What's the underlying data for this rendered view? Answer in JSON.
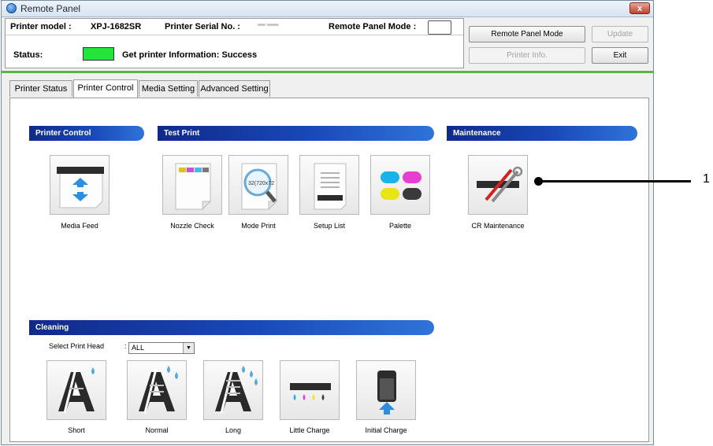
{
  "window": {
    "title": "Remote Panel",
    "close_glyph": "x"
  },
  "header": {
    "printer_model_label": "Printer model :",
    "printer_model_value": "XPJ-1682SR",
    "serial_label": "Printer Serial No. :",
    "serial_value_redacted": "•••• ••••••",
    "remote_mode_label": "Remote Panel Mode :",
    "status_label": "Status:",
    "status_text": "Get printer Information: Success",
    "status_color": "#22e43a"
  },
  "buttons": {
    "remote_panel_mode": "Remote Panel Mode",
    "update": "Update",
    "printer_info": "Printer Info.",
    "exit": "Exit"
  },
  "tabs": [
    {
      "label": "Printer Status"
    },
    {
      "label": "Printer Control",
      "active": true
    },
    {
      "label": "Media Setting"
    },
    {
      "label": "Advanced Setting"
    }
  ],
  "sections": {
    "printer_control": "Printer Control",
    "test_print": "Test Print",
    "maintenance": "Maintenance",
    "cleaning": "Cleaning"
  },
  "tiles": {
    "media_feed": "Media Feed",
    "nozzle_check": "Nozzle Check",
    "mode_print": "Mode Print",
    "mode_print_icon_text": "32(720x72",
    "setup_list": "Setup List",
    "palette": "Palette",
    "cr_maintenance": "CR Maintenance",
    "short": "Short",
    "normal": "Normal",
    "long": "Long",
    "little_charge": "Little Charge",
    "initial_charge": "Initial Charge"
  },
  "cleaning": {
    "select_head_label": "Select Print Head",
    "select_head_colon": ":",
    "select_head_value": "ALL"
  },
  "callout": {
    "number": "1"
  },
  "colors": {
    "accent_green": "#5db445",
    "section_blue": "#1948b8"
  }
}
